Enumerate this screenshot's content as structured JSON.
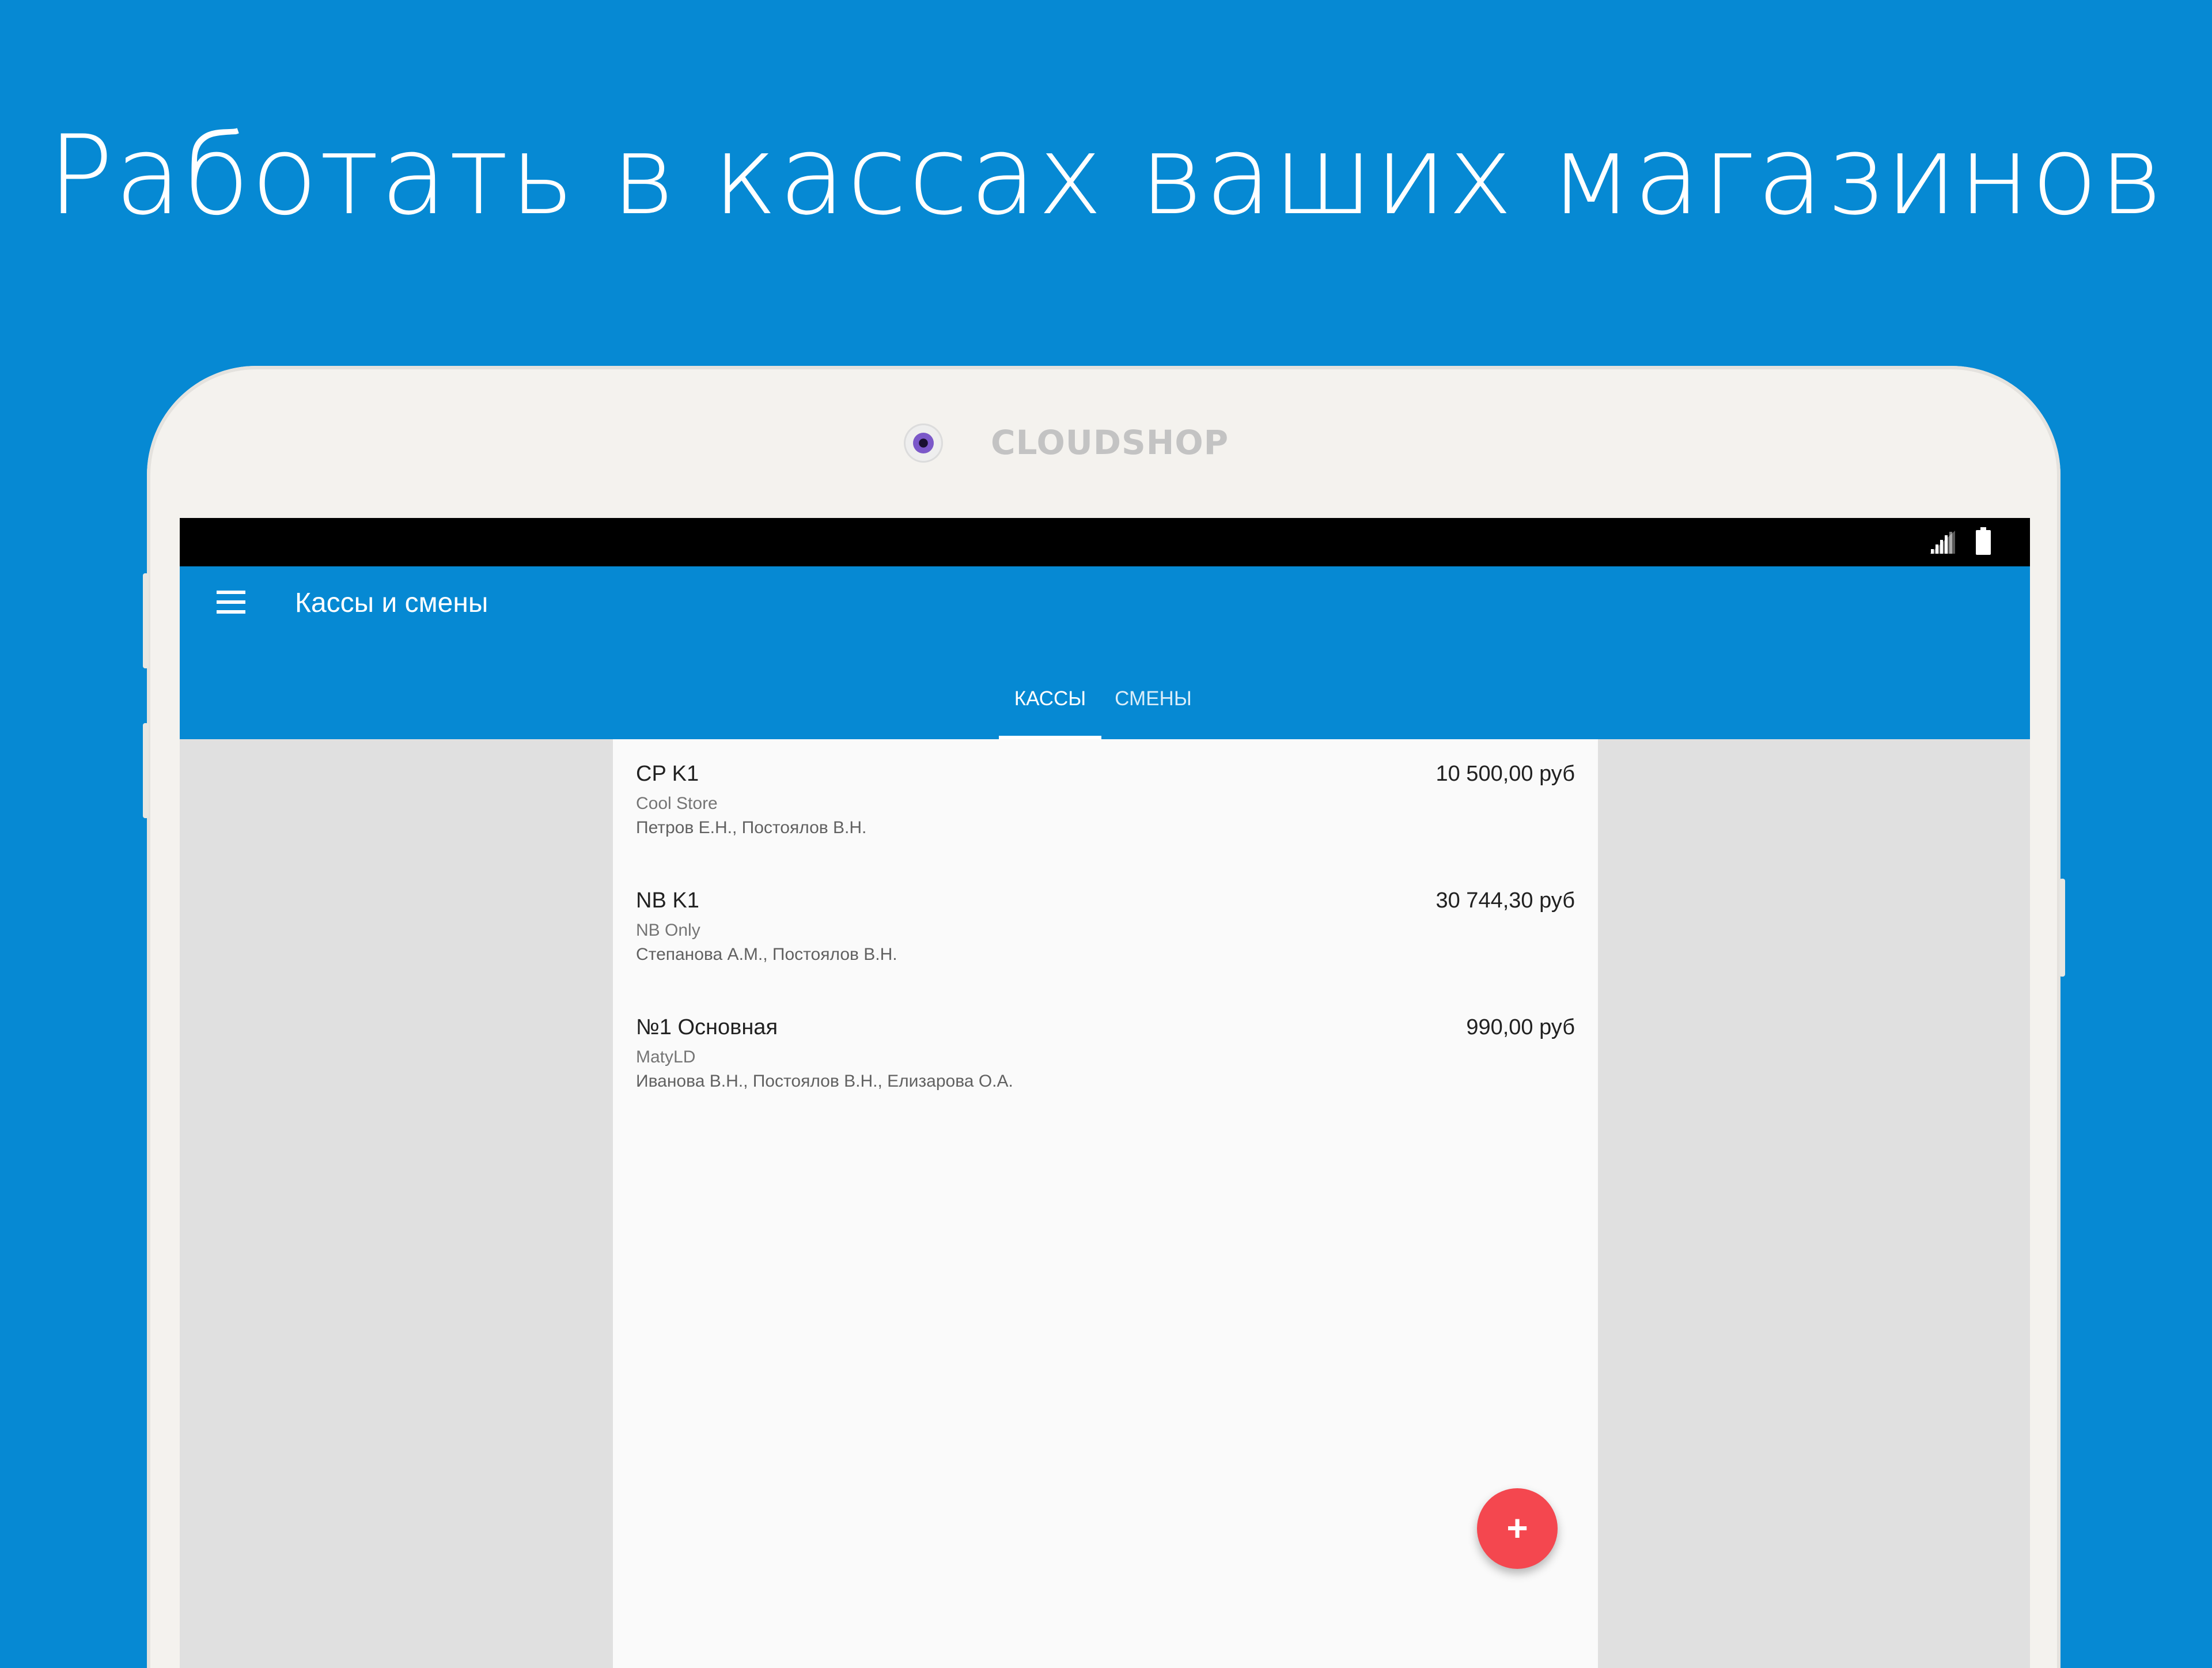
{
  "headline": "Работать в кассах ваших магазинов",
  "device": {
    "brand": "CLOUDSHOP"
  },
  "status_bar": {
    "icons": [
      "signal-icon",
      "battery-icon"
    ]
  },
  "app_bar": {
    "title": "Кассы и смены",
    "menu_icon": "menu-icon",
    "tabs": [
      {
        "label": "КАССЫ",
        "selected": true
      },
      {
        "label": "СМЕНЫ",
        "selected": false
      }
    ]
  },
  "registers": [
    {
      "name": "CP K1",
      "store": "Cool Store",
      "staff": "Петров Е.Н., Постоялов В.Н.",
      "amount": "10 500,00 руб"
    },
    {
      "name": "NB K1",
      "store": "NB Only",
      "staff": "Степанова А.М., Постоялов В.Н.",
      "amount": "30 744,30 руб"
    },
    {
      "name": "№1 Основная",
      "store": "MatyLD",
      "staff": "Иванова В.Н., Постоялов В.Н., Елизарова О.А.",
      "amount": "990,00 руб"
    }
  ],
  "fab": {
    "label": "+",
    "icon": "plus-icon"
  },
  "colors": {
    "background": "#0689d3",
    "app_bar": "#0689d3",
    "fab": "#f4474f",
    "device_frame": "#f4f2ee",
    "screen_side": "#e0e0e0",
    "list_background": "#fafafa"
  }
}
